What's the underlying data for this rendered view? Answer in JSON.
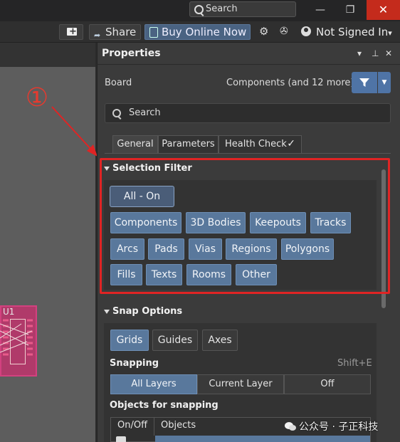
{
  "titlebar": {
    "search_label": "Search",
    "minimize_glyph": "—",
    "restore_glyph": "❐",
    "close_glyph": "✕"
  },
  "toolbar": {
    "share_label": "Share",
    "buy_label": "Buy Online Now",
    "user_label": "Not Signed In",
    "user_caret": "▾"
  },
  "annotation": {
    "number": "①",
    "color": "#e02424"
  },
  "canvas": {
    "component_label": "U1"
  },
  "properties": {
    "title": "Properties",
    "board_label": "Board",
    "filter_summary": "Components (and 12 more)",
    "search_placeholder": "Search",
    "tabs": [
      "General",
      "Parameters",
      "Health Check"
    ],
    "accent_color": "#59789c"
  },
  "selection_filter": {
    "title": "Selection Filter",
    "all_on": "All - On",
    "chips": [
      "Components",
      "3D Bodies",
      "Keepouts",
      "Tracks",
      "Arcs",
      "Pads",
      "Vias",
      "Regions",
      "Polygons",
      "Fills",
      "Texts",
      "Rooms",
      "Other"
    ]
  },
  "snap_options": {
    "title": "Snap Options",
    "grid_chips": [
      "Grids",
      "Guides",
      "Axes"
    ],
    "snapping_label": "Snapping",
    "snapping_shortcut": "Shift+E",
    "snapping_modes": [
      "All Layers",
      "Current Layer",
      "Off"
    ],
    "objects_label": "Objects for snapping",
    "table_headers": [
      "On/Off",
      "Objects"
    ]
  },
  "watermark": {
    "text": "公众号 · 子正科技"
  }
}
